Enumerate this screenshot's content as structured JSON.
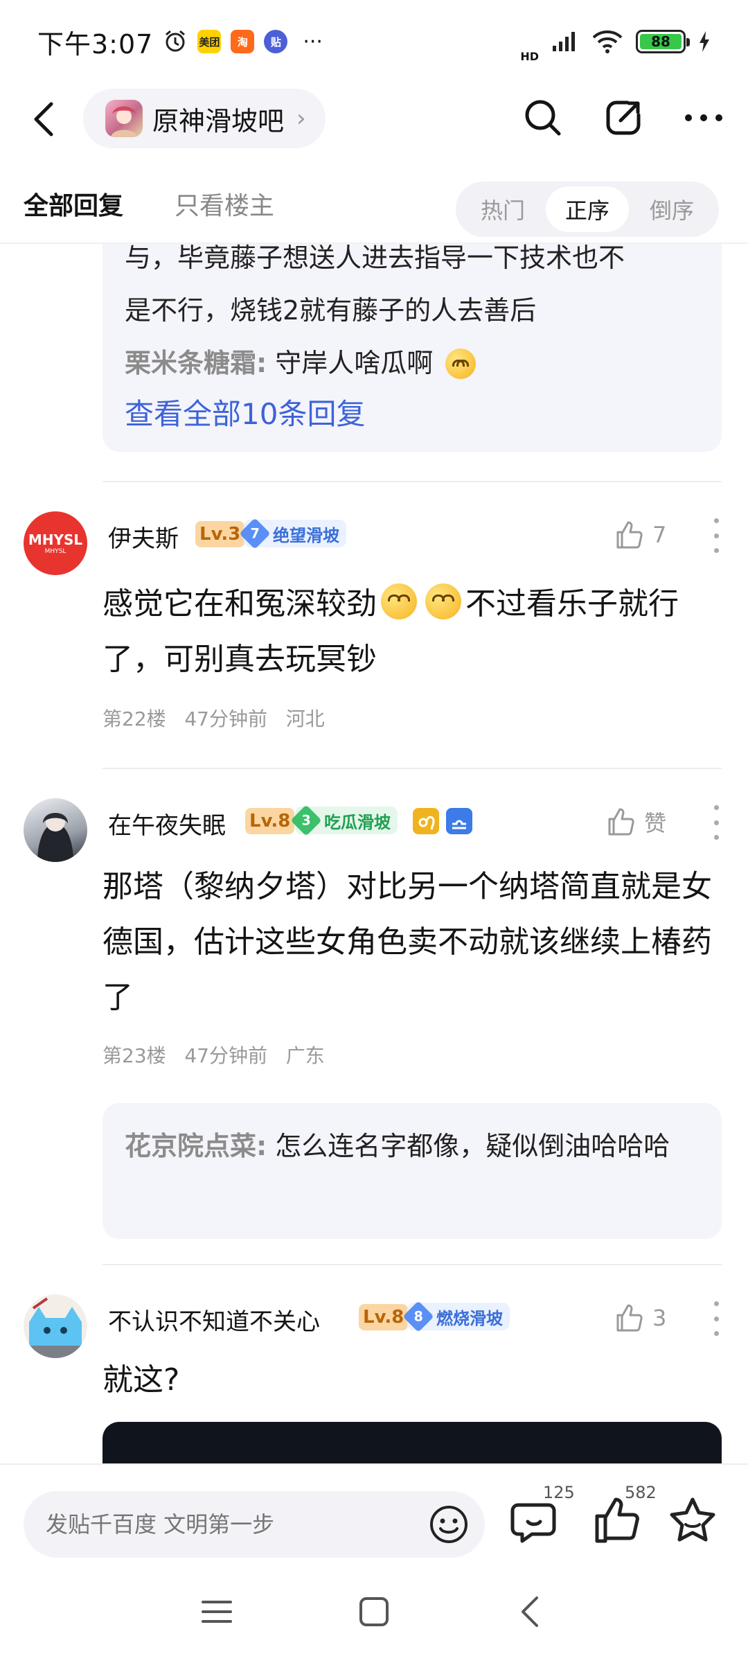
{
  "status_bar": {
    "time": "下午3:07",
    "app_icons": [
      "美团",
      "淘",
      "贴"
    ],
    "more": "···",
    "network": "HD",
    "battery": "88"
  },
  "nav": {
    "forum_name": "原神滑坡吧",
    "arrow": "›"
  },
  "tabs": {
    "all_replies": "全部回复",
    "owner_only": "只看楼主",
    "sort_options": [
      "热门",
      "正序",
      "倒序"
    ],
    "active_sort": "正序"
  },
  "prev_reply_box": {
    "line1": "与，毕竟藤子想送人进去指导一下技术也不",
    "line2": "是不行，烧钱2就有藤子的人去善后",
    "sub_user": "栗米条糖霜:",
    "sub_text": "守岸人啥瓜啊",
    "view_all": "查看全部10条回复"
  },
  "posts": [
    {
      "avatar_text": "MHYSL",
      "avatar_sub": "MHYSL",
      "username": "伊夫斯",
      "level": "Lv.3",
      "badge_num": "7",
      "badge_text": "绝望滑坡",
      "like_count": "7",
      "text_before": "感觉它在和冤深较劲",
      "text_after": "不过看乐子就行了，可别真去玩冥钞",
      "floor": "第22楼",
      "time": "47分钟前",
      "location": "河北"
    },
    {
      "username": "在午夜失眠",
      "level": "Lv.8",
      "badge_num": "3",
      "badge_text": "吃瓜滑坡",
      "like_label": "赞",
      "text": "那塔（黎纳夕塔）对比另一个纳塔简直就是女德国，估计这些女角色卖不动就该继续上椿药了",
      "floor": "第23楼",
      "time": "47分钟前",
      "location": "广东",
      "sub_reply_user": "花京院点菜:",
      "sub_reply_text": "怎么连名字都像，疑似倒油哈哈哈"
    },
    {
      "username": "不认识不知道不关心",
      "level": "Lv.8",
      "badge_num": "8",
      "badge_text": "燃烧滑坡",
      "like_count": "3",
      "text": "就这?"
    }
  ],
  "bottom_bar": {
    "input_placeholder": "发贴千百度 文明第一步",
    "comment_count": "125",
    "like_count": "582"
  },
  "colors": {
    "accent_blue": "#3d63d8",
    "reply_bg": "#f4f4fb",
    "level_bg": "#fbd6a2"
  }
}
